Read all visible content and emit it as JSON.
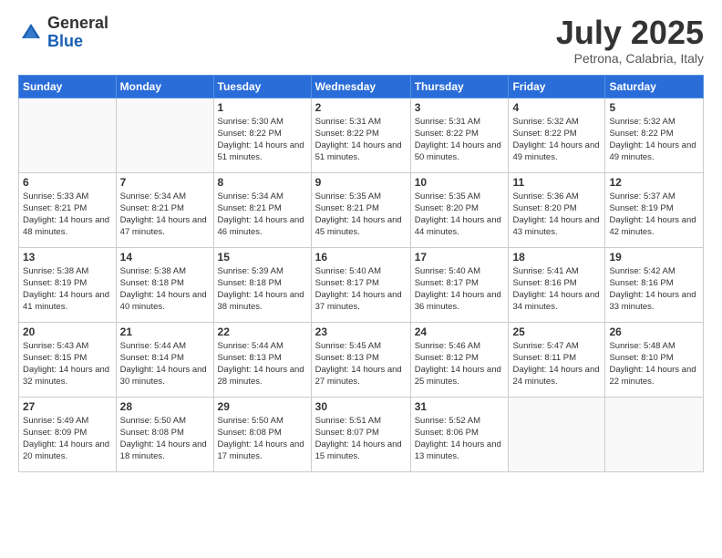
{
  "logo": {
    "general": "General",
    "blue": "Blue"
  },
  "title": "July 2025",
  "location": "Petrona, Calabria, Italy",
  "days_of_week": [
    "Sunday",
    "Monday",
    "Tuesday",
    "Wednesday",
    "Thursday",
    "Friday",
    "Saturday"
  ],
  "weeks": [
    [
      {
        "day": "",
        "sunrise": "",
        "sunset": "",
        "daylight": ""
      },
      {
        "day": "",
        "sunrise": "",
        "sunset": "",
        "daylight": ""
      },
      {
        "day": "1",
        "sunrise": "Sunrise: 5:30 AM",
        "sunset": "Sunset: 8:22 PM",
        "daylight": "Daylight: 14 hours and 51 minutes."
      },
      {
        "day": "2",
        "sunrise": "Sunrise: 5:31 AM",
        "sunset": "Sunset: 8:22 PM",
        "daylight": "Daylight: 14 hours and 51 minutes."
      },
      {
        "day": "3",
        "sunrise": "Sunrise: 5:31 AM",
        "sunset": "Sunset: 8:22 PM",
        "daylight": "Daylight: 14 hours and 50 minutes."
      },
      {
        "day": "4",
        "sunrise": "Sunrise: 5:32 AM",
        "sunset": "Sunset: 8:22 PM",
        "daylight": "Daylight: 14 hours and 49 minutes."
      },
      {
        "day": "5",
        "sunrise": "Sunrise: 5:32 AM",
        "sunset": "Sunset: 8:22 PM",
        "daylight": "Daylight: 14 hours and 49 minutes."
      }
    ],
    [
      {
        "day": "6",
        "sunrise": "Sunrise: 5:33 AM",
        "sunset": "Sunset: 8:21 PM",
        "daylight": "Daylight: 14 hours and 48 minutes."
      },
      {
        "day": "7",
        "sunrise": "Sunrise: 5:34 AM",
        "sunset": "Sunset: 8:21 PM",
        "daylight": "Daylight: 14 hours and 47 minutes."
      },
      {
        "day": "8",
        "sunrise": "Sunrise: 5:34 AM",
        "sunset": "Sunset: 8:21 PM",
        "daylight": "Daylight: 14 hours and 46 minutes."
      },
      {
        "day": "9",
        "sunrise": "Sunrise: 5:35 AM",
        "sunset": "Sunset: 8:21 PM",
        "daylight": "Daylight: 14 hours and 45 minutes."
      },
      {
        "day": "10",
        "sunrise": "Sunrise: 5:35 AM",
        "sunset": "Sunset: 8:20 PM",
        "daylight": "Daylight: 14 hours and 44 minutes."
      },
      {
        "day": "11",
        "sunrise": "Sunrise: 5:36 AM",
        "sunset": "Sunset: 8:20 PM",
        "daylight": "Daylight: 14 hours and 43 minutes."
      },
      {
        "day": "12",
        "sunrise": "Sunrise: 5:37 AM",
        "sunset": "Sunset: 8:19 PM",
        "daylight": "Daylight: 14 hours and 42 minutes."
      }
    ],
    [
      {
        "day": "13",
        "sunrise": "Sunrise: 5:38 AM",
        "sunset": "Sunset: 8:19 PM",
        "daylight": "Daylight: 14 hours and 41 minutes."
      },
      {
        "day": "14",
        "sunrise": "Sunrise: 5:38 AM",
        "sunset": "Sunset: 8:18 PM",
        "daylight": "Daylight: 14 hours and 40 minutes."
      },
      {
        "day": "15",
        "sunrise": "Sunrise: 5:39 AM",
        "sunset": "Sunset: 8:18 PM",
        "daylight": "Daylight: 14 hours and 38 minutes."
      },
      {
        "day": "16",
        "sunrise": "Sunrise: 5:40 AM",
        "sunset": "Sunset: 8:17 PM",
        "daylight": "Daylight: 14 hours and 37 minutes."
      },
      {
        "day": "17",
        "sunrise": "Sunrise: 5:40 AM",
        "sunset": "Sunset: 8:17 PM",
        "daylight": "Daylight: 14 hours and 36 minutes."
      },
      {
        "day": "18",
        "sunrise": "Sunrise: 5:41 AM",
        "sunset": "Sunset: 8:16 PM",
        "daylight": "Daylight: 14 hours and 34 minutes."
      },
      {
        "day": "19",
        "sunrise": "Sunrise: 5:42 AM",
        "sunset": "Sunset: 8:16 PM",
        "daylight": "Daylight: 14 hours and 33 minutes."
      }
    ],
    [
      {
        "day": "20",
        "sunrise": "Sunrise: 5:43 AM",
        "sunset": "Sunset: 8:15 PM",
        "daylight": "Daylight: 14 hours and 32 minutes."
      },
      {
        "day": "21",
        "sunrise": "Sunrise: 5:44 AM",
        "sunset": "Sunset: 8:14 PM",
        "daylight": "Daylight: 14 hours and 30 minutes."
      },
      {
        "day": "22",
        "sunrise": "Sunrise: 5:44 AM",
        "sunset": "Sunset: 8:13 PM",
        "daylight": "Daylight: 14 hours and 28 minutes."
      },
      {
        "day": "23",
        "sunrise": "Sunrise: 5:45 AM",
        "sunset": "Sunset: 8:13 PM",
        "daylight": "Daylight: 14 hours and 27 minutes."
      },
      {
        "day": "24",
        "sunrise": "Sunrise: 5:46 AM",
        "sunset": "Sunset: 8:12 PM",
        "daylight": "Daylight: 14 hours and 25 minutes."
      },
      {
        "day": "25",
        "sunrise": "Sunrise: 5:47 AM",
        "sunset": "Sunset: 8:11 PM",
        "daylight": "Daylight: 14 hours and 24 minutes."
      },
      {
        "day": "26",
        "sunrise": "Sunrise: 5:48 AM",
        "sunset": "Sunset: 8:10 PM",
        "daylight": "Daylight: 14 hours and 22 minutes."
      }
    ],
    [
      {
        "day": "27",
        "sunrise": "Sunrise: 5:49 AM",
        "sunset": "Sunset: 8:09 PM",
        "daylight": "Daylight: 14 hours and 20 minutes."
      },
      {
        "day": "28",
        "sunrise": "Sunrise: 5:50 AM",
        "sunset": "Sunset: 8:08 PM",
        "daylight": "Daylight: 14 hours and 18 minutes."
      },
      {
        "day": "29",
        "sunrise": "Sunrise: 5:50 AM",
        "sunset": "Sunset: 8:08 PM",
        "daylight": "Daylight: 14 hours and 17 minutes."
      },
      {
        "day": "30",
        "sunrise": "Sunrise: 5:51 AM",
        "sunset": "Sunset: 8:07 PM",
        "daylight": "Daylight: 14 hours and 15 minutes."
      },
      {
        "day": "31",
        "sunrise": "Sunrise: 5:52 AM",
        "sunset": "Sunset: 8:06 PM",
        "daylight": "Daylight: 14 hours and 13 minutes."
      },
      {
        "day": "",
        "sunrise": "",
        "sunset": "",
        "daylight": ""
      },
      {
        "day": "",
        "sunrise": "",
        "sunset": "",
        "daylight": ""
      }
    ]
  ]
}
